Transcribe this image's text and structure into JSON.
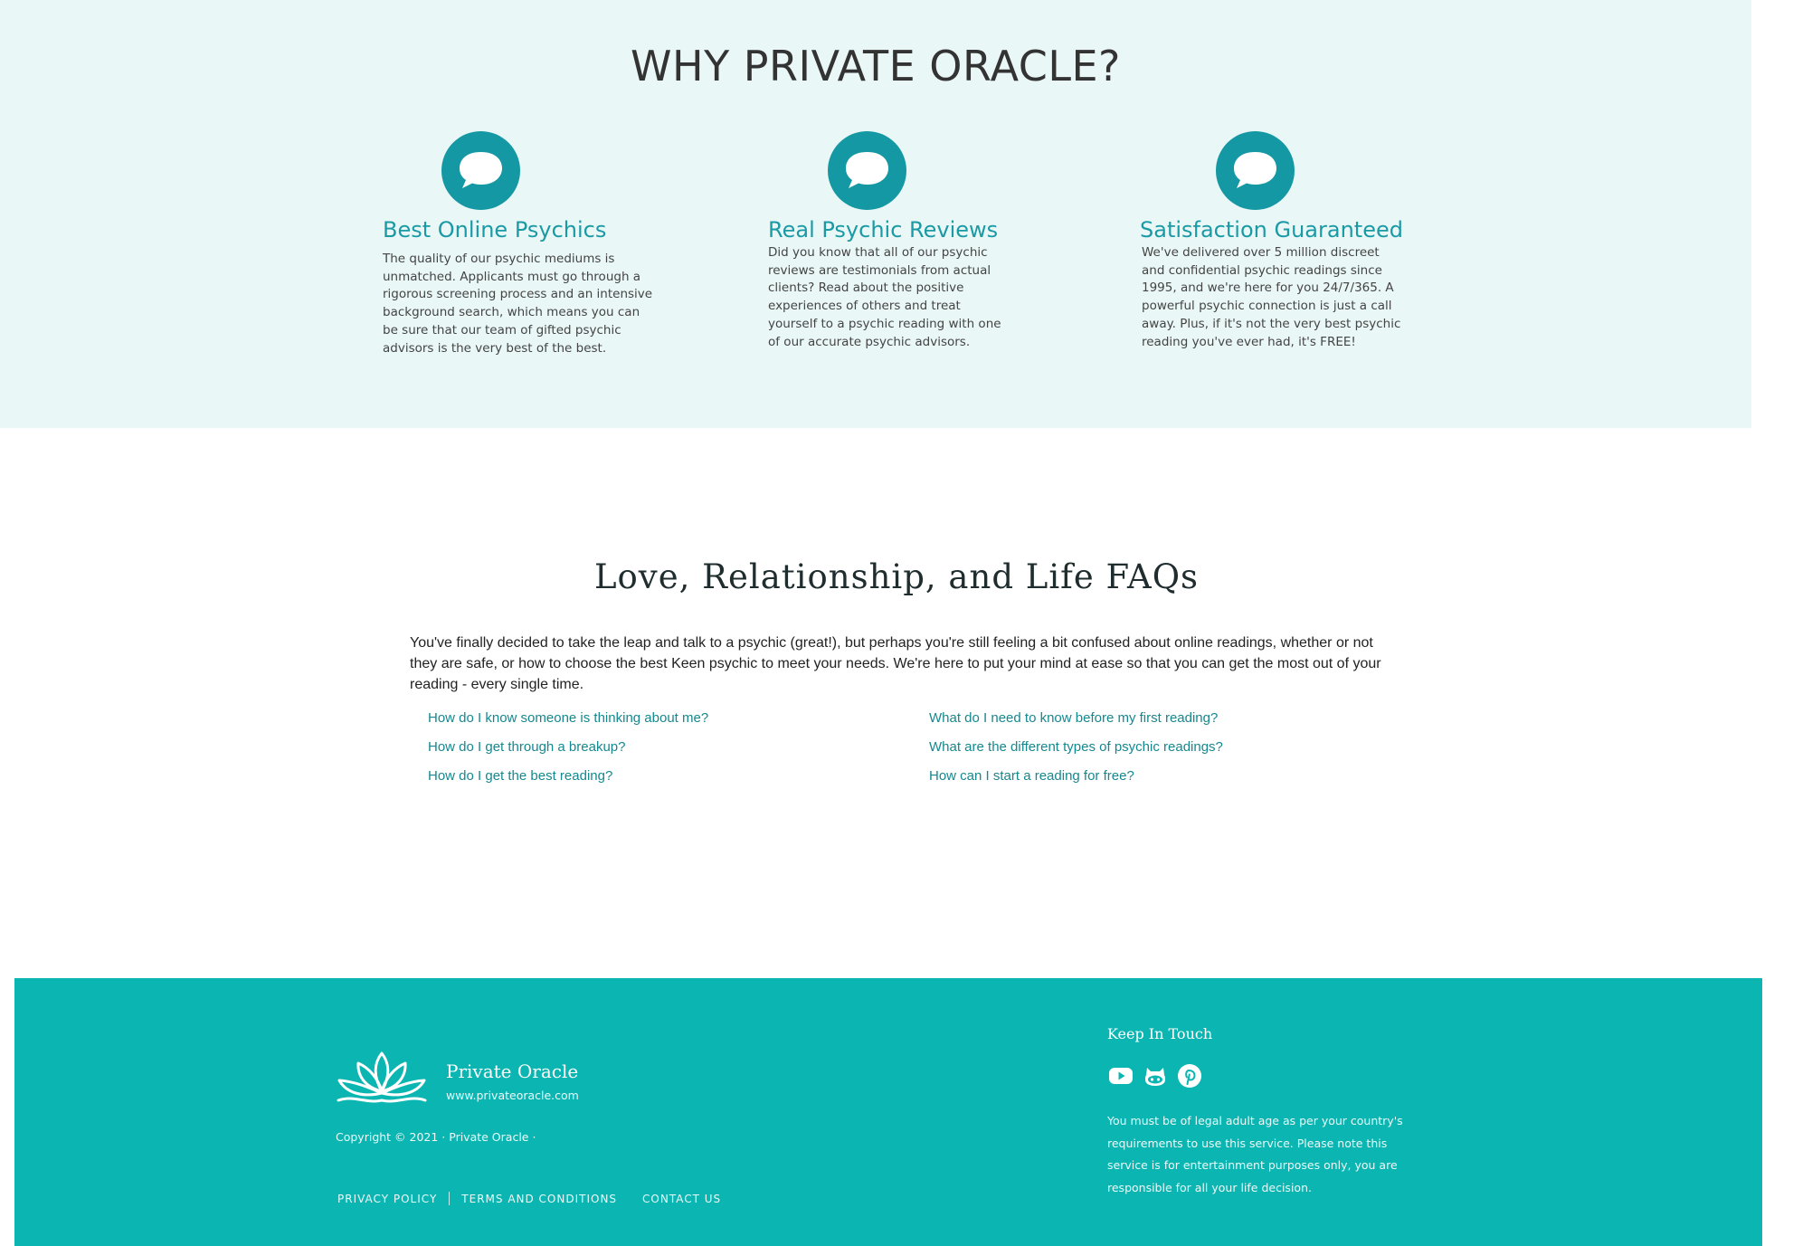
{
  "why": {
    "title": "WHY PRIVATE ORACLE?",
    "features": [
      {
        "icon": "chat-bubble-icon",
        "title": "Best Online Psychics",
        "text": "The quality of our psychic mediums is unmatched. Applicants must go through a rigorous screening process and an intensive background search, which means you can be sure that our team of gifted psychic advisors is the very best of the best."
      },
      {
        "icon": "chat-bubble-icon",
        "title": "Real Psychic Reviews",
        "text": "Did you know that all of our psychic reviews are testimonials from actual clients? Read about the positive experiences of others and treat yourself to a psychic reading with one of our accurate psychic advisors."
      },
      {
        "icon": "chat-bubble-icon",
        "title": "Satisfaction Guaranteed",
        "text": "We've delivered over 5 million discreet and confidential psychic readings since 1995, and we're here for you 24/7/365. A powerful psychic connection is just a call away. Plus, if it's not the very best psychic reading you've ever had, it's FREE!"
      }
    ]
  },
  "faq": {
    "title": "Love, Relationship, and Life FAQs",
    "intro": "You've finally decided to take the leap and talk to a psychic (great!), but perhaps you're still feeling a bit confused about online readings, whether or not they are safe, or how to choose the best Keen psychic to meet your needs. We're here to put your mind at ease so that you can get the most out of your reading - every single time.",
    "questions": [
      "How do I know someone is thinking about me?",
      "How do I get through a breakup?",
      "How do I get the best reading?",
      "What do I need to know before my first reading?",
      "What are the different types of psychic readings?",
      "How can I start a reading for free?"
    ]
  },
  "footer": {
    "brand_name": "Private Oracle",
    "brand_url": "www.privateoracle.com",
    "copyright": "Copyright © 2021 · Private Oracle ·",
    "links": [
      "PRIVACY POLICY",
      "TERMS AND CONDITIONS",
      "CONTACT US"
    ],
    "keep_in_touch": "Keep In Touch",
    "social_icons": [
      "youtube-icon",
      "github-icon",
      "pinterest-icon"
    ],
    "disclaimer": "You must be of legal adult age as per your country's requirements to use this service. Please note this service is for entertainment purposes only, you are responsible for all your life decision."
  },
  "colors": {
    "why_background": "#eaf7f7",
    "accent_teal": "#1499a4",
    "footer_background": "#0bb5b1",
    "faq_link": "#15888f"
  }
}
